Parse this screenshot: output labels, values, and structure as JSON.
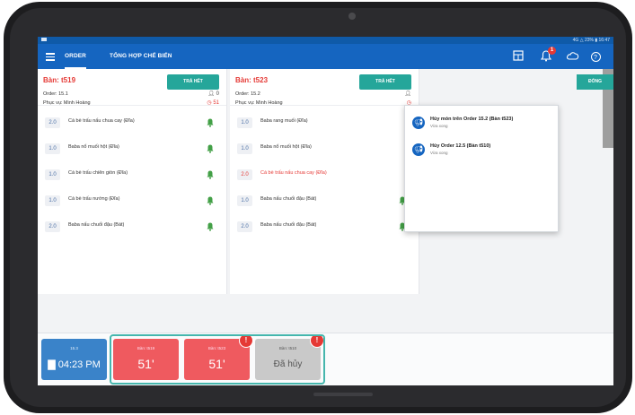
{
  "status": {
    "right_text": "4G △ 23% ▮ 16:47"
  },
  "appbar": {
    "tabs": [
      {
        "label": "ORDER"
      },
      {
        "label": "TỔNG HỢP CHẾ BIẾN"
      }
    ],
    "notification_count": "1"
  },
  "cards": [
    {
      "table": "Bàn: t519",
      "order": "Order: 15.1",
      "staff": "Phục vụ: Minh Hoàng",
      "button": "TRẢ HẾT",
      "guests": "0",
      "elapsed": "51",
      "items": [
        {
          "qty": "2.0",
          "name": "Cá bè trấu nấu chua cay (Đĩa)",
          "red": false
        },
        {
          "qty": "1.0",
          "name": "Baba nổ muối hột (Đĩa)",
          "red": false
        },
        {
          "qty": "1.0",
          "name": "Cá bè trấu chiên giòn (Đĩa)",
          "red": false
        },
        {
          "qty": "1.0",
          "name": "Cá bè trấu nướng (Đĩa)",
          "red": false
        },
        {
          "qty": "2.0",
          "name": "Baba nấu chuối đậu (Bát)",
          "red": false
        }
      ]
    },
    {
      "table": "Bàn: t523",
      "order": "Order: 15.2",
      "staff": "Phục vụ: Minh Hoàng",
      "button": "TRẢ HẾT",
      "guests": "",
      "elapsed": "",
      "items": [
        {
          "qty": "1.0",
          "name": "Baba rang muối (Đĩa)",
          "red": false
        },
        {
          "qty": "1.0",
          "name": "Baba nổ muối hột (Đĩa)",
          "red": false
        },
        {
          "qty": "2.0",
          "name": "Cá bè trấu nấu chua cay (Đĩa)",
          "red": true
        },
        {
          "qty": "1.0",
          "name": "Baba nấu chuối đậu (Bát)",
          "red": false
        },
        {
          "qty": "2.0",
          "name": "Baba nấu chuối đậu (Bát)",
          "red": false
        }
      ]
    }
  ],
  "third_card": {
    "button": "ĐÓNG"
  },
  "notifications": [
    {
      "title": "Hủy món trên Order 15.2 (Bàn t523)",
      "sub": "Vừa xong"
    },
    {
      "title": "Hủy Order 12.5 (Bàn t510)",
      "sub": "Vừa xong"
    }
  ],
  "bottom": {
    "clock": {
      "label": "15.3",
      "time": "04:23 PM"
    },
    "tiles": [
      {
        "label": "Bàn: t519",
        "value": "51'",
        "badge": ""
      },
      {
        "label": "Bàn: t523",
        "value": "51'",
        "badge": "!"
      },
      {
        "label": "Bàn: t510",
        "value": "Đã hủy",
        "badge": "!"
      }
    ]
  },
  "colors": {
    "primary": "#1565c0",
    "accent_teal": "#25a69a",
    "alert_red": "#e53935"
  },
  "icons": [
    "menu-icon",
    "kitchen-board-icon",
    "bell-icon",
    "cloud-icon",
    "help-icon",
    "person-icon",
    "clock-icon",
    "megaphone-icon"
  ]
}
